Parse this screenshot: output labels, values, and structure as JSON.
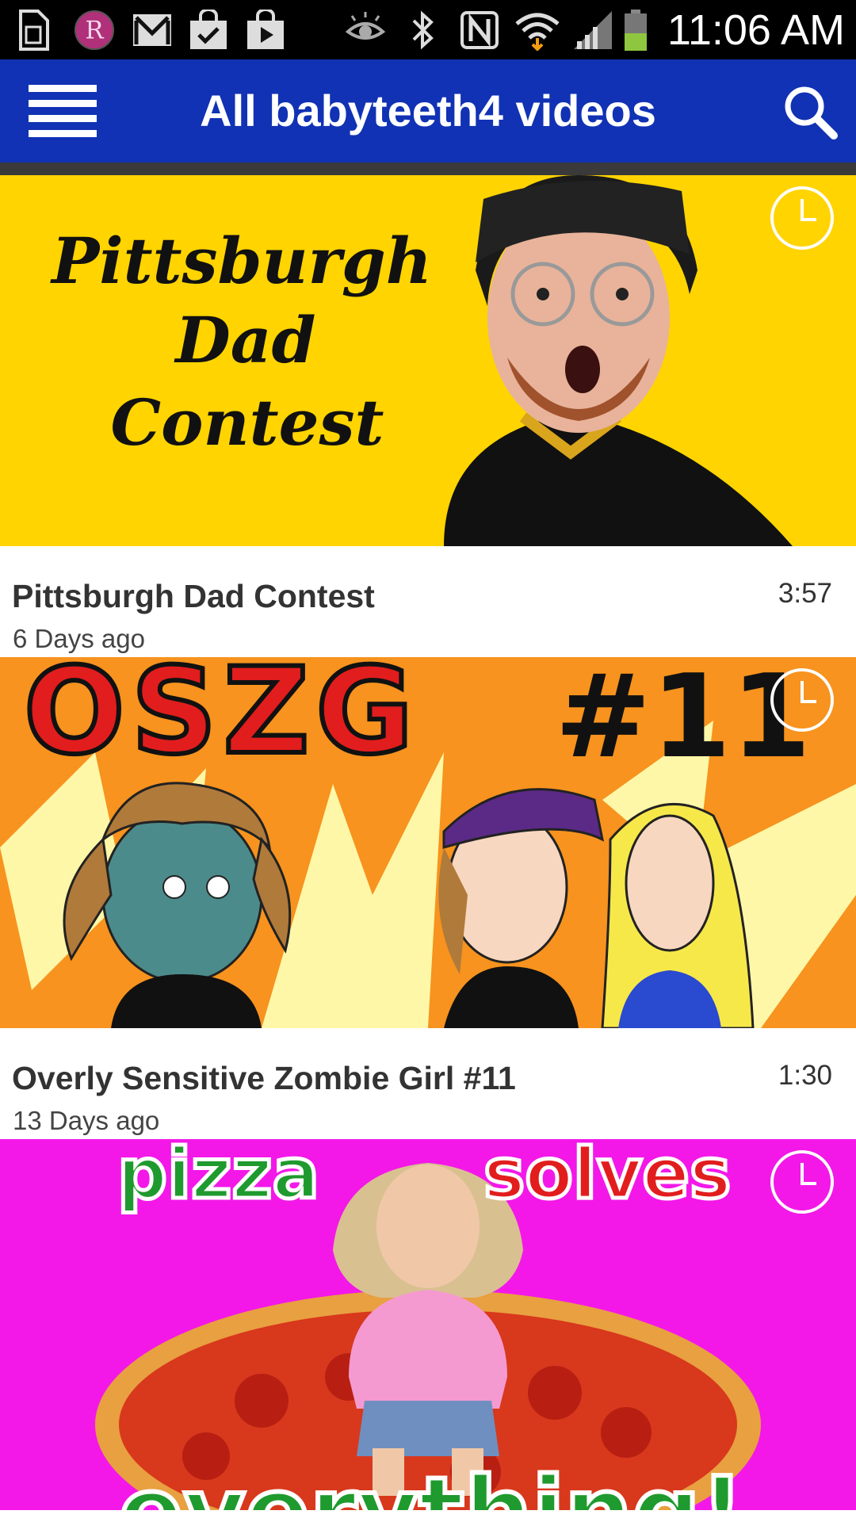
{
  "status_bar": {
    "time": "11:06 AM",
    "icons": [
      "sim-card-icon",
      "app-r-icon",
      "gmail-icon",
      "shopping-bag-check-icon",
      "play-store-icon",
      "eye-icon",
      "bluetooth-icon",
      "nfc-icon",
      "wifi-icon",
      "signal-icon",
      "battery-icon"
    ]
  },
  "app_bar": {
    "title": "All babyteeth4 videos",
    "menu_icon": "hamburger-menu-icon",
    "search_icon": "search-icon",
    "color": "#1132b4"
  },
  "videos": [
    {
      "title": "Pittsburgh Dad Contest",
      "age": "6 Days ago",
      "duration": "3:57",
      "thumbnail_text": [
        "Pittsburgh",
        "Dad",
        "Contest"
      ],
      "thumbnail_bg": "#ffd400"
    },
    {
      "title": "Overly Sensitive Zombie Girl #11",
      "age": "13 Days ago",
      "duration": "1:30",
      "thumbnail_text": [
        "OSZG",
        "#11"
      ],
      "thumbnail_bg": "#f7931e"
    },
    {
      "title": "",
      "age": "",
      "duration": "",
      "thumbnail_text": [
        "pizza",
        "solves",
        "everything!"
      ],
      "thumbnail_bg": "#f318e8"
    }
  ]
}
